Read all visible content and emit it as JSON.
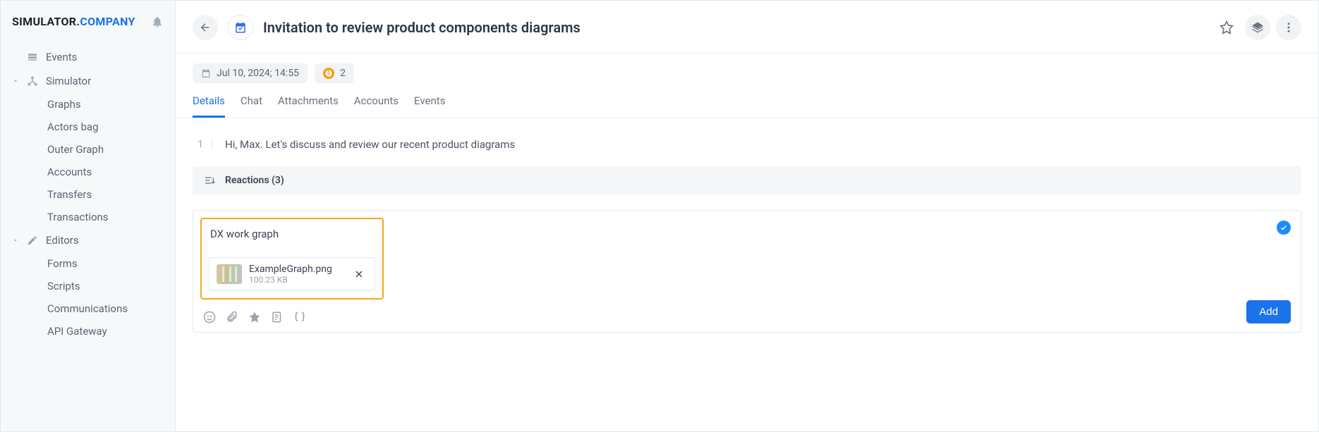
{
  "logo": {
    "part1": "SIMULATOR",
    "sep": ".",
    "part2": "COMPANY"
  },
  "sidebar": {
    "events": "Events",
    "groups": [
      {
        "label": "Simulator",
        "items": [
          "Graphs",
          "Actors bag",
          "Outer Graph",
          "Accounts",
          "Transfers",
          "Transactions"
        ]
      },
      {
        "label": "Editors",
        "items": [
          "Forms",
          "Scripts",
          "Communications",
          "API Gateway"
        ]
      }
    ]
  },
  "header": {
    "title": "Invitation to review product components diagrams"
  },
  "meta": {
    "date": "Jul 10, 2024; 14:55",
    "coin_count": "2"
  },
  "tabs": [
    "Details",
    "Chat",
    "Attachments",
    "Accounts",
    "Events"
  ],
  "description": {
    "num": "1",
    "text": "Hi, Max. Let's discuss and review our recent product diagrams"
  },
  "reactions": {
    "label": "Reactions (3)"
  },
  "compose": {
    "text": "DX work graph",
    "attachment": {
      "name": "ExampleGraph.png",
      "size": "100.23 KB"
    },
    "add_label": "Add"
  }
}
